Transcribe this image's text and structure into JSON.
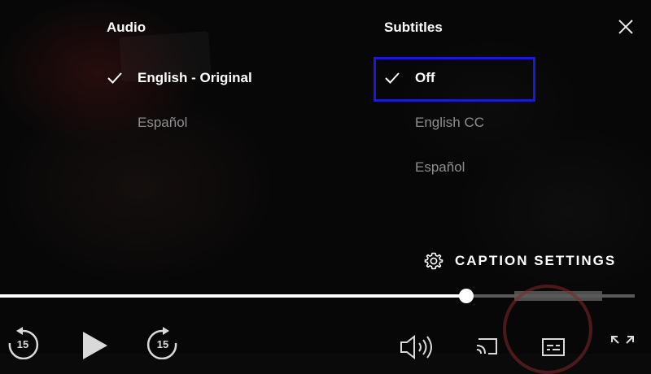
{
  "audio": {
    "title": "Audio",
    "options": [
      {
        "label": "English - Original",
        "selected": true
      },
      {
        "label": "Español",
        "selected": false
      }
    ]
  },
  "subtitles": {
    "title": "Subtitles",
    "options": [
      {
        "label": "Off",
        "selected": true
      },
      {
        "label": "English CC",
        "selected": false
      },
      {
        "label": "Español",
        "selected": false
      }
    ]
  },
  "caption_settings": {
    "label": "CAPTION SETTINGS",
    "icon": "gear-icon"
  },
  "close": {
    "icon": "close-icon"
  },
  "playback": {
    "progress": 0.735,
    "skip_back_seconds": "15",
    "skip_forward_seconds": "15"
  },
  "colors": {
    "focus_outline": "#1a1ad6",
    "selected_text": "#ffffff",
    "unselected_text": "#8e8e8e",
    "track": "#5a5a5a"
  },
  "icons": [
    "check-icon",
    "gear-icon",
    "close-icon",
    "skip-back-icon",
    "play-icon",
    "skip-forward-icon",
    "volume-icon",
    "cast-icon",
    "subtitles-icon",
    "fullscreen-icon"
  ]
}
